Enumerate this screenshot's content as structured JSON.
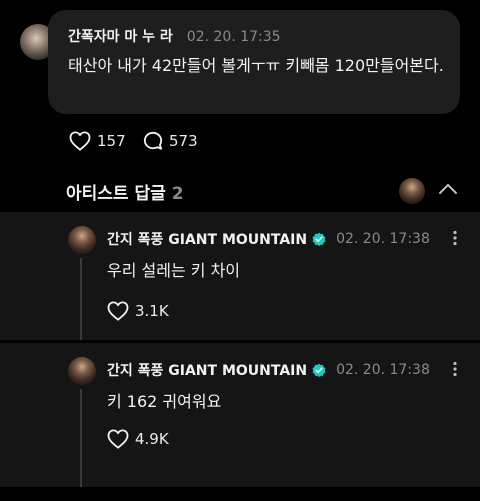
{
  "post": {
    "author": "간폭자마 마 누 라",
    "time": "02. 20. 17:35",
    "text": "태산아 내가 42만들어 볼게ㅜㅠ 키빼몸 120만들어본다.",
    "likes": "157",
    "replies": "573"
  },
  "artist_replies": {
    "title": "아티스트 답글",
    "count": "2"
  },
  "replies": [
    {
      "author": "간지 폭풍 GIANT MOUNTAIN",
      "time": "02. 20. 17:38",
      "text": "우리 설레는 키 차이",
      "likes": "3.1K"
    },
    {
      "author": "간지 폭풍 GIANT MOUNTAIN",
      "time": "02. 20. 17:38",
      "text": "키 162 귀여워요",
      "likes": "4.9K"
    }
  ],
  "colors": {
    "background": "#000000",
    "bubble": "#1e1e1e",
    "reply_bg": "#151515",
    "verified": "#1ec9c0",
    "muted_text": "#8a8a8a"
  },
  "icons": [
    "heart-icon",
    "comment-bubble-icon",
    "chevron-up-icon",
    "more-vertical-icon",
    "verified-badge-icon"
  ]
}
